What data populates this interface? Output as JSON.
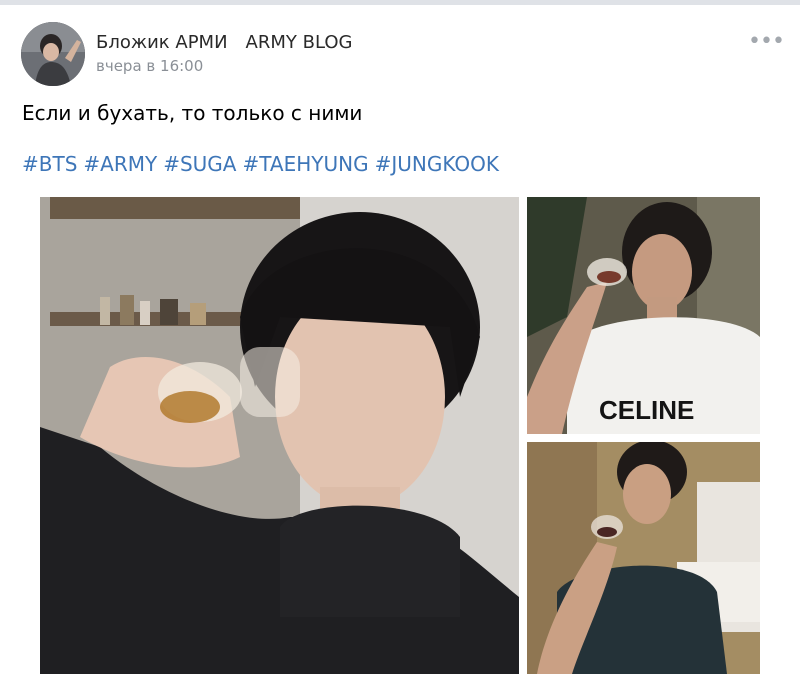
{
  "post": {
    "author": "Бложик АРМИ",
    "blog_name": "ARMY BLOG",
    "time": "вчера в 16:00",
    "text": "Если и бухать, то только с ними",
    "hashtags": [
      "#BTS",
      "#ARMY",
      "#SUGA",
      "#TAEHYUNG",
      "#JUNGKOOK"
    ],
    "more_icon": "more-dots-icon"
  },
  "photos": {
    "second_shirt_text": "CELINE"
  }
}
